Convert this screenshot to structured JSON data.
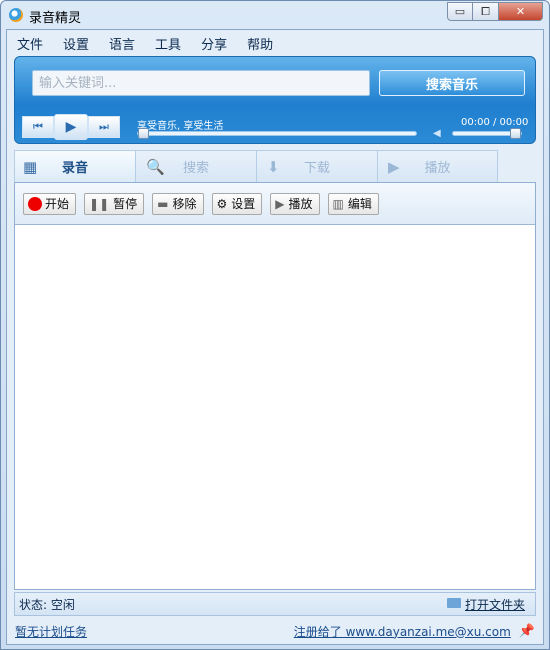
{
  "window": {
    "title": "录音精灵",
    "min_symbol": "▭",
    "max_symbol": "⧠",
    "close_symbol": "✕"
  },
  "menu": [
    "文件",
    "设置",
    "语言",
    "工具",
    "分享",
    "帮助"
  ],
  "player": {
    "search_placeholder": "输入关键词...",
    "search_button": "搜索音乐",
    "prev_symbol": "⏮",
    "play_symbol": "▶",
    "next_symbol": "⏭",
    "song_text": "享受音乐, 享受生活",
    "time_text": "00:00 / 00:00",
    "progress": 0,
    "volume": 1
  },
  "tabs": [
    {
      "label": "录音",
      "icon": "waveform-icon",
      "glyph": "▦",
      "active": true
    },
    {
      "label": "搜索",
      "icon": "search-icon",
      "glyph": "🔍",
      "active": false
    },
    {
      "label": "下载",
      "icon": "download-icon",
      "glyph": "⬇",
      "active": false
    },
    {
      "label": "播放",
      "icon": "play-icon",
      "glyph": "▶",
      "active": false
    }
  ],
  "toolbar": [
    {
      "label": "开始",
      "icon": "record-icon",
      "glyph": "",
      "cls": "start"
    },
    {
      "label": "暂停",
      "icon": "pause-icon",
      "glyph": "❚❚",
      "cls": "pause"
    },
    {
      "label": "移除",
      "icon": "remove-icon",
      "glyph": "▬",
      "cls": "remove"
    },
    {
      "label": "设置",
      "icon": "gear-icon",
      "glyph": "⚙",
      "cls": "settings"
    },
    {
      "label": "播放",
      "icon": "play-icon",
      "glyph": "▶",
      "cls": "play"
    },
    {
      "label": "编辑",
      "icon": "equalizer-icon",
      "glyph": "▥",
      "cls": "edit"
    }
  ],
  "status": {
    "text": "状态: 空闲",
    "open_folder": "打开文件夹"
  },
  "bottom": {
    "schedule": "暂无计划任务",
    "registered": "注册给了 www.dayanzai.me@xu.com"
  },
  "colors": {
    "accent": "#1f7fcf",
    "record": "#ee0000"
  }
}
